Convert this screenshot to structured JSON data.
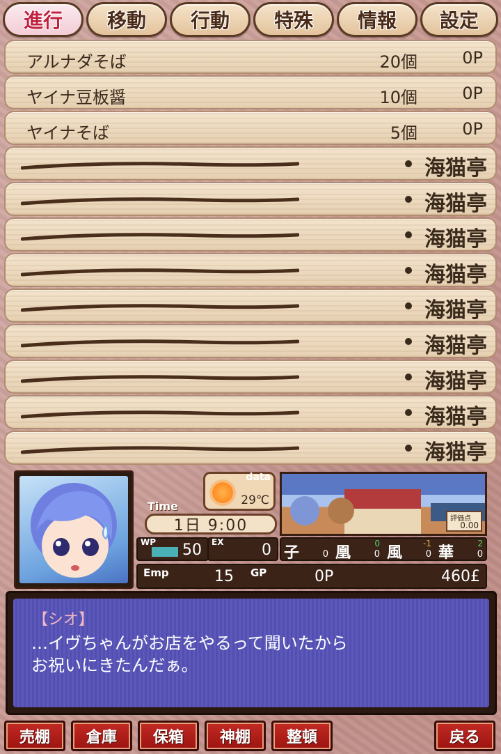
{
  "tabs": [
    {
      "label": "進行",
      "active": true
    },
    {
      "label": "移動"
    },
    {
      "label": "行動"
    },
    {
      "label": "特殊"
    },
    {
      "label": "情報"
    },
    {
      "label": "設定"
    }
  ],
  "items": [
    {
      "name": "アルナダそば",
      "qty": "20個",
      "points": "0P"
    },
    {
      "name": "ヤイナ豆板醤",
      "qty": "10個",
      "points": "0P"
    },
    {
      "name": "ヤイナそば",
      "qty": "5個",
      "points": "0P"
    }
  ],
  "empty_slot_shop": "海猫亭",
  "empty_slot_count": 9,
  "weather": {
    "label": "data",
    "temp": "29℃",
    "icon": "sun-icon"
  },
  "time": {
    "label": "Time",
    "value": "1日 9:00"
  },
  "scene": {
    "eval_label": "評価点",
    "eval_value": "0.00"
  },
  "stats": {
    "wp_label": "WP",
    "wp_value": "50",
    "wp_fraction": 0.5,
    "ex_label": "EX",
    "ex_value": "0"
  },
  "affinity": [
    {
      "char": "子",
      "top": "",
      "bottom": "0"
    },
    {
      "char": "凰",
      "top": "0",
      "bottom": "0"
    },
    {
      "char": "風",
      "top": "-1",
      "bottom": "0"
    },
    {
      "char": "華",
      "top": "2",
      "bottom": "0"
    }
  ],
  "money": {
    "emp_label": "Emp",
    "emp_value": "15",
    "gp_label": "GP",
    "gp_value": "0P",
    "gold_value": "460£"
  },
  "dialog": {
    "speaker": "【シオ】",
    "line1": "…イヴちゃんがお店をやるって聞いたから",
    "line2": "お祝いにきたんだぁ。"
  },
  "buttons": {
    "sell_shelf": "売棚",
    "storage": "倉庫",
    "safe_box": "保箱",
    "shrine": "神棚",
    "organize": "整頓",
    "back": "戻る"
  }
}
